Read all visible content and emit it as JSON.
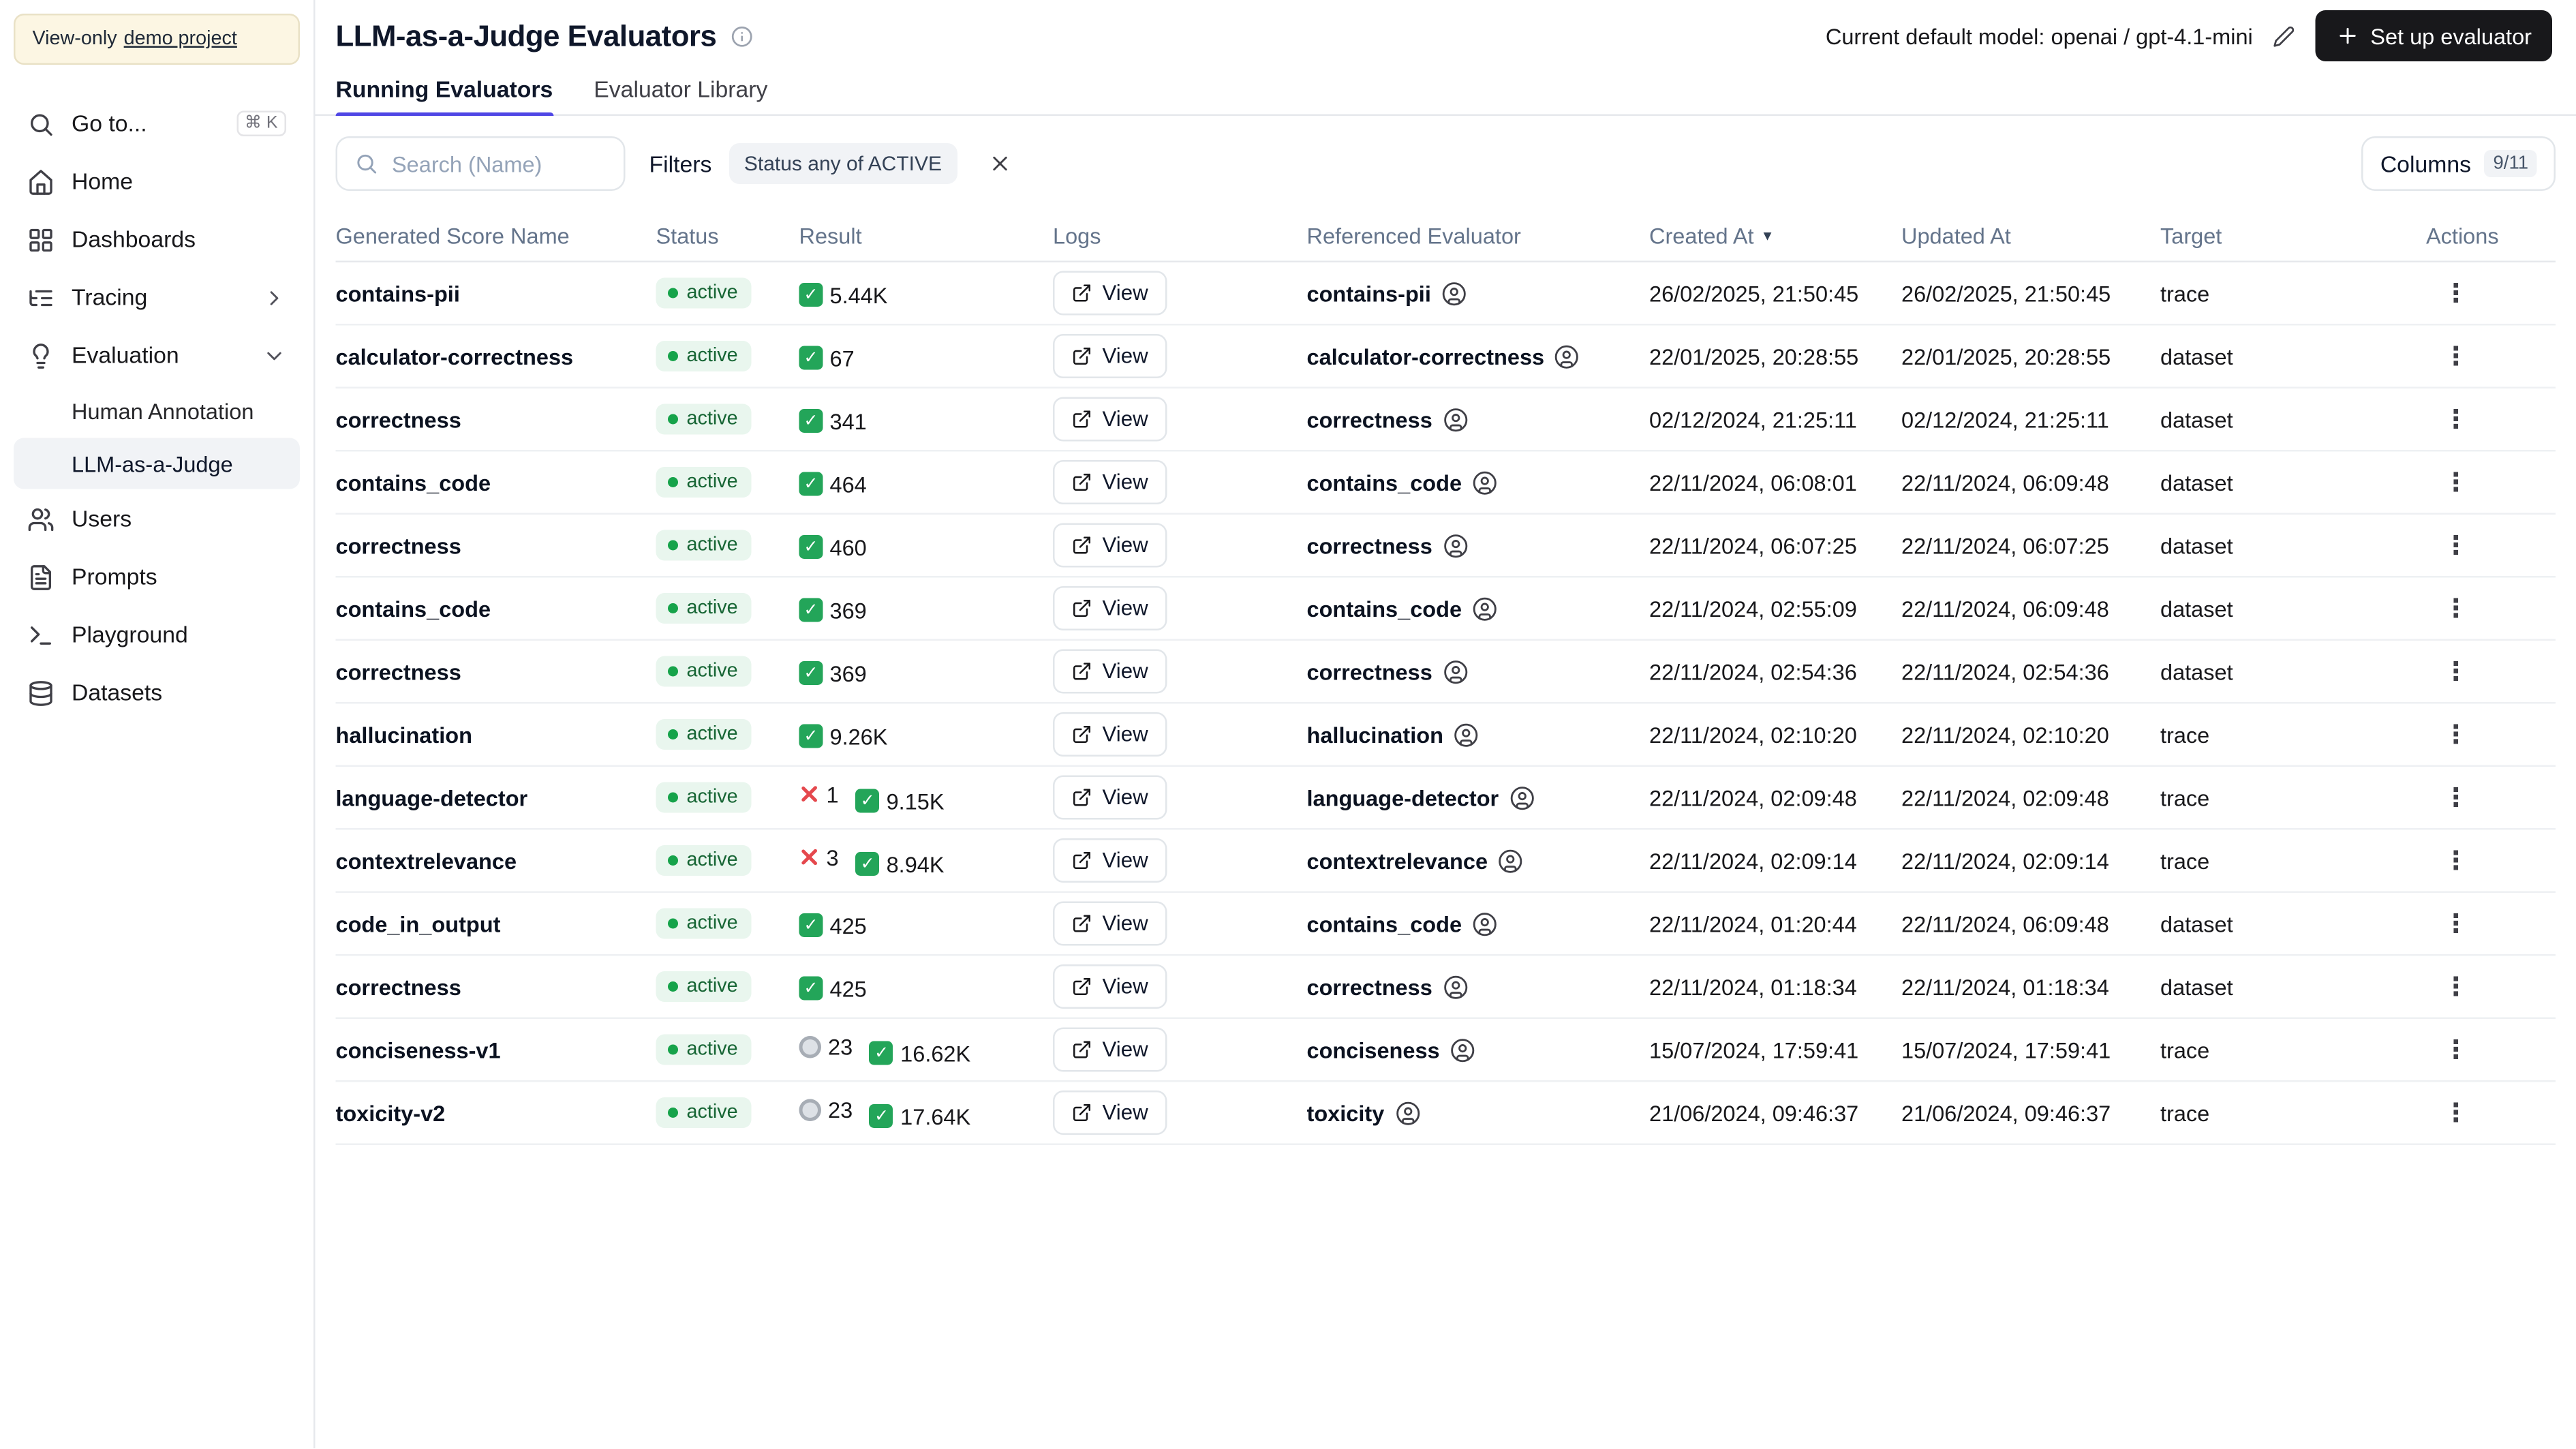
{
  "colors": {
    "accent": "#4f46e5",
    "active_badge_bg": "#e9f6ee",
    "active_badge_text": "#166534",
    "active_badge_dot": "#16a34a",
    "success_green": "#23a559",
    "error_red": "#e5484d",
    "pending_gray": "#dde1e6",
    "primary_button_bg": "#18181b",
    "banner_bg": "#fcf6e3",
    "banner_border": "#e9e1c6"
  },
  "icons": {
    "more_vertical": "⋮",
    "sort_desc": "▼"
  },
  "sidebar": {
    "banner": {
      "text": "View-only",
      "link": "demo project"
    },
    "goto": {
      "label": "Go to...",
      "shortcut": "⌘ K"
    },
    "items": {
      "home": "Home",
      "dashboards": "Dashboards",
      "tracing": "Tracing",
      "evaluation": "Evaluation",
      "human_annotation": "Human Annotation",
      "llm_judge": "LLM-as-a-Judge",
      "users": "Users",
      "prompts": "Prompts",
      "playground": "Playground",
      "datasets": "Datasets"
    }
  },
  "header": {
    "title": "LLM-as-a-Judge Evaluators",
    "default_model_prefix": "Current default model:",
    "default_model_value": "openai / gpt-4.1-mini",
    "setup_button": "Set up evaluator"
  },
  "tabs": [
    {
      "label": "Running Evaluators",
      "active": true
    },
    {
      "label": "Evaluator Library",
      "active": false
    }
  ],
  "toolbar": {
    "search_placeholder": "Search (Name)",
    "filters_label": "Filters",
    "filter_chip": "Status any of ACTIVE",
    "columns_label": "Columns",
    "columns_count": "9/11"
  },
  "table": {
    "columns": [
      "Generated Score Name",
      "Status",
      "Result",
      "Logs",
      "Referenced Evaluator",
      "Created At",
      "Updated At",
      "Target",
      "Actions"
    ],
    "sort_column": "Created At",
    "sort_direction": "desc",
    "view_label": "View",
    "rows": [
      {
        "name": "contains-pii",
        "status": "active",
        "result": [
          {
            "type": "success",
            "value": "5.44K"
          }
        ],
        "referenced": "contains-pii",
        "created": "26/02/2025, 21:50:45",
        "updated": "26/02/2025, 21:50:45",
        "target": "trace"
      },
      {
        "name": "calculator-correctness",
        "status": "active",
        "result": [
          {
            "type": "success",
            "value": "67"
          }
        ],
        "referenced": "calculator-correctness",
        "created": "22/01/2025, 20:28:55",
        "updated": "22/01/2025, 20:28:55",
        "target": "dataset"
      },
      {
        "name": "correctness",
        "status": "active",
        "result": [
          {
            "type": "success",
            "value": "341"
          }
        ],
        "referenced": "correctness",
        "created": "02/12/2024, 21:25:11",
        "updated": "02/12/2024, 21:25:11",
        "target": "dataset"
      },
      {
        "name": "contains_code",
        "status": "active",
        "result": [
          {
            "type": "success",
            "value": "464"
          }
        ],
        "referenced": "contains_code",
        "created": "22/11/2024, 06:08:01",
        "updated": "22/11/2024, 06:09:48",
        "target": "dataset"
      },
      {
        "name": "correctness",
        "status": "active",
        "result": [
          {
            "type": "success",
            "value": "460"
          }
        ],
        "referenced": "correctness",
        "created": "22/11/2024, 06:07:25",
        "updated": "22/11/2024, 06:07:25",
        "target": "dataset"
      },
      {
        "name": "contains_code",
        "status": "active",
        "result": [
          {
            "type": "success",
            "value": "369"
          }
        ],
        "referenced": "contains_code",
        "created": "22/11/2024, 02:55:09",
        "updated": "22/11/2024, 06:09:48",
        "target": "dataset"
      },
      {
        "name": "correctness",
        "status": "active",
        "result": [
          {
            "type": "success",
            "value": "369"
          }
        ],
        "referenced": "correctness",
        "created": "22/11/2024, 02:54:36",
        "updated": "22/11/2024, 02:54:36",
        "target": "dataset"
      },
      {
        "name": "hallucination",
        "status": "active",
        "result": [
          {
            "type": "success",
            "value": "9.26K"
          }
        ],
        "referenced": "hallucination",
        "created": "22/11/2024, 02:10:20",
        "updated": "22/11/2024, 02:10:20",
        "target": "trace"
      },
      {
        "name": "language-detector",
        "status": "active",
        "result": [
          {
            "type": "error",
            "value": "1"
          },
          {
            "type": "success",
            "value": "9.15K"
          }
        ],
        "referenced": "language-detector",
        "created": "22/11/2024, 02:09:48",
        "updated": "22/11/2024, 02:09:48",
        "target": "trace"
      },
      {
        "name": "contextrelevance",
        "status": "active",
        "result": [
          {
            "type": "error",
            "value": "3"
          },
          {
            "type": "success",
            "value": "8.94K"
          }
        ],
        "referenced": "contextrelevance",
        "created": "22/11/2024, 02:09:14",
        "updated": "22/11/2024, 02:09:14",
        "target": "trace"
      },
      {
        "name": "code_in_output",
        "status": "active",
        "result": [
          {
            "type": "success",
            "value": "425"
          }
        ],
        "referenced": "contains_code",
        "created": "22/11/2024, 01:20:44",
        "updated": "22/11/2024, 06:09:48",
        "target": "dataset"
      },
      {
        "name": "correctness",
        "status": "active",
        "result": [
          {
            "type": "success",
            "value": "425"
          }
        ],
        "referenced": "correctness",
        "created": "22/11/2024, 01:18:34",
        "updated": "22/11/2024, 01:18:34",
        "target": "dataset"
      },
      {
        "name": "conciseness-v1",
        "status": "active",
        "result": [
          {
            "type": "pending",
            "value": "23"
          },
          {
            "type": "success",
            "value": "16.62K"
          }
        ],
        "referenced": "conciseness",
        "created": "15/07/2024, 17:59:41",
        "updated": "15/07/2024, 17:59:41",
        "target": "trace"
      },
      {
        "name": "toxicity-v2",
        "status": "active",
        "result": [
          {
            "type": "pending",
            "value": "23"
          },
          {
            "type": "success",
            "value": "17.64K"
          }
        ],
        "referenced": "toxicity",
        "created": "21/06/2024, 09:46:37",
        "updated": "21/06/2024, 09:46:37",
        "target": "trace"
      }
    ]
  }
}
